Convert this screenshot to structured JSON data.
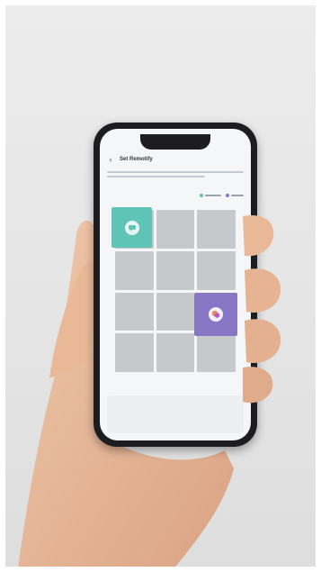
{
  "app": {
    "title": "Set Remotify",
    "description": "",
    "legend": [
      {
        "label": "",
        "color": "#5fc3b6"
      },
      {
        "label": "",
        "color": "#8676c4"
      }
    ]
  },
  "grid": {
    "rows": 4,
    "cols": 3,
    "tiles": [
      {
        "name": "teal-tile",
        "color": "#5fc3b6",
        "icon": "chat-bubble-icon"
      },
      {
        "name": "purple-tile",
        "color": "#8676c4",
        "icon": "chat-bubbles-icon"
      }
    ]
  },
  "colors": {
    "background": "#e6e6e6",
    "phone_frame": "#1d1d1f",
    "screen": "#f4f6f8",
    "cell": "#c6c9cc",
    "teal": "#5fc3b6",
    "purple": "#8676c4",
    "skin": "#e8b99a"
  }
}
